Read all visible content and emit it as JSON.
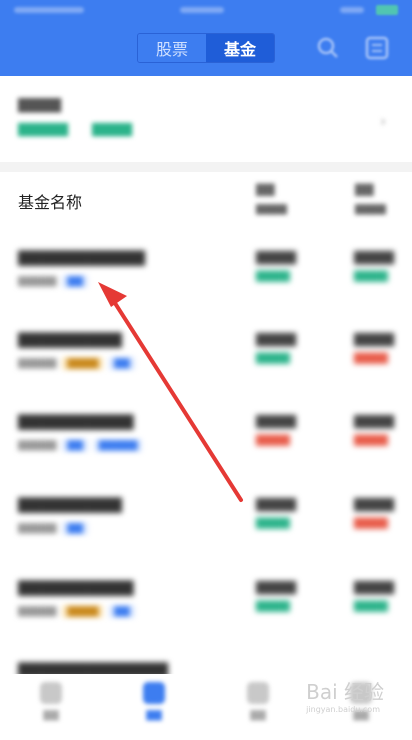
{
  "header": {
    "tabs": [
      "股票",
      "基金"
    ],
    "active_tab": "基金",
    "background": "#3d7df0"
  },
  "column_header": {
    "title": "基金名称"
  },
  "icons": {
    "search": "search-icon",
    "menu": "menu-icon"
  },
  "watermark": {
    "brand": "Bai 经验",
    "url": "jingyan.baidu.com"
  }
}
